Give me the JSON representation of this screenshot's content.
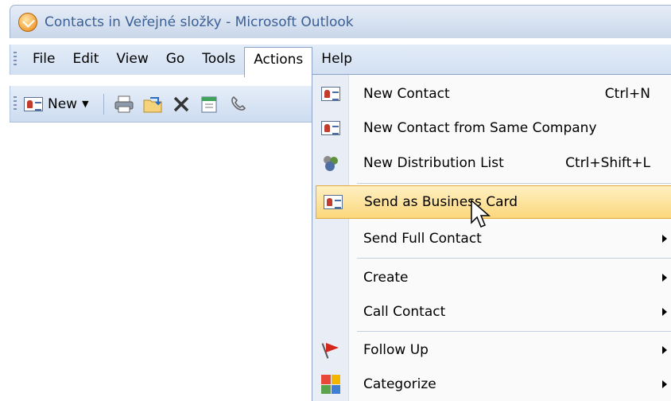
{
  "window": {
    "title": "Contacts in Veřejné složky - Microsoft Outlook",
    "icon": "outlook-icon"
  },
  "menubar": {
    "items": [
      {
        "label": "File",
        "mnemonic": "F"
      },
      {
        "label": "Edit",
        "mnemonic": "E"
      },
      {
        "label": "View",
        "mnemonic": "V"
      },
      {
        "label": "Go",
        "mnemonic": "G"
      },
      {
        "label": "Tools",
        "mnemonic": "T"
      },
      {
        "label": "Actions",
        "mnemonic": "A",
        "active": true
      },
      {
        "label": "Help",
        "mnemonic": "H"
      }
    ]
  },
  "toolbar": {
    "new_label": "New",
    "icons": [
      "print-icon",
      "move-to-folder-icon",
      "delete-icon",
      "address-book-icon",
      "phone-icon"
    ]
  },
  "actions_menu": {
    "items": [
      {
        "label": "New Contact",
        "shortcut": "Ctrl+N",
        "icon": "contact-card-icon",
        "submenu": false
      },
      {
        "label": "New Contact from Same Company",
        "shortcut": "",
        "icon": "contact-card-icon",
        "submenu": false
      },
      {
        "label": "New Distribution List",
        "shortcut": "Ctrl+Shift+L",
        "icon": "distribution-list-icon",
        "submenu": false
      },
      {
        "label": "Send as Business Card",
        "shortcut": "",
        "icon": "business-card-icon",
        "submenu": false,
        "highlighted": true
      },
      {
        "label": "Send Full Contact",
        "shortcut": "",
        "icon": "",
        "submenu": true
      },
      {
        "label": "Create",
        "shortcut": "",
        "icon": "",
        "submenu": true
      },
      {
        "label": "Call Contact",
        "shortcut": "",
        "icon": "",
        "submenu": true
      },
      {
        "label": "Follow Up",
        "shortcut": "",
        "icon": "flag-icon",
        "submenu": true
      },
      {
        "label": "Categorize",
        "shortcut": "",
        "icon": "categorize-icon",
        "submenu": true
      }
    ]
  },
  "colors": {
    "title_text": "#3b5f95",
    "highlight_top": "#fff0c2",
    "highlight_bottom": "#fbd77c",
    "highlight_border": "#e0a93a"
  }
}
